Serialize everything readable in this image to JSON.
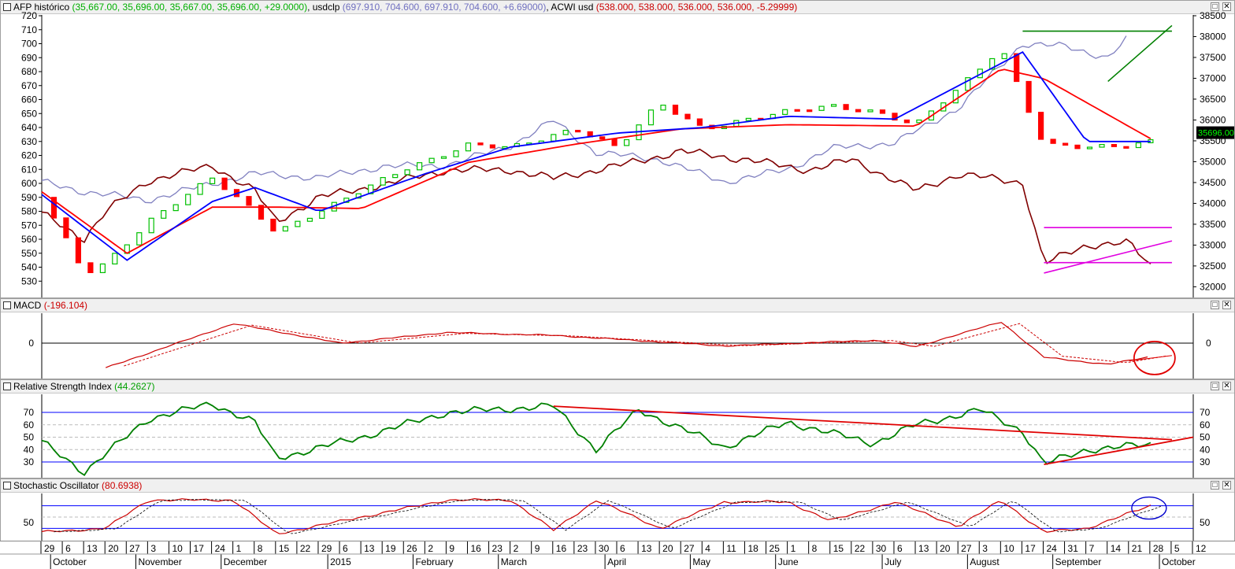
{
  "colors": {
    "afp_up": "#00c000",
    "afp_down": "#ff0000",
    "usdclp": "#8080c0",
    "acwi": "#800000",
    "sma_fast": "#0000ff",
    "sma_slow": "#ff0000",
    "trend_green": "#008000",
    "trend_magenta": "#e000e0",
    "macd": "#cc0000",
    "rsi": "#008000",
    "stoch": "#cc0000",
    "bands": "#0000ff",
    "circle": "#e00000"
  },
  "main": {
    "title_prefix": "AFP histórico",
    "afp_values": "(35,667.00, 35,696.00, 35,667.00, 35,696.00, +29.0000)",
    "usd_name": "usdclp",
    "usd_values": "(697.910, 704.600, 697.910, 704.600, +6.69000)",
    "acwi_name": "ACWI usd",
    "acwi_values": "(538.000, 538.000, 536.000, 536.000, -5.29999)",
    "last_price_badge": "35696.00",
    "left_ticks": [
      "720",
      "710",
      "700",
      "690",
      "680",
      "670",
      "660",
      "650",
      "640",
      "630",
      "620",
      "610",
      "600",
      "590",
      "580",
      "570",
      "560",
      "550",
      "540",
      "530"
    ],
    "right_ticks": [
      "38500",
      "38000",
      "37500",
      "37000",
      "36500",
      "36000",
      "35500",
      "35000",
      "34500",
      "34000",
      "33500",
      "33000",
      "32500",
      "32000"
    ]
  },
  "macd": {
    "title": "MACD",
    "value": "(-196.104)",
    "tick_left": "0",
    "tick_right": "0"
  },
  "rsi": {
    "title": "Relative Strength Index",
    "value": "(44.2627)",
    "ticks": [
      "70",
      "60",
      "50",
      "40",
      "30"
    ]
  },
  "stoch": {
    "title": "Stochastic Oscillator",
    "value": "(80.6938)",
    "tick_left": "50",
    "tick_right": "50"
  },
  "xaxis": {
    "days": [
      "29",
      "6",
      "13",
      "20",
      "27",
      "3",
      "10",
      "17",
      "24",
      "1",
      "8",
      "15",
      "22",
      "29",
      "6",
      "13",
      "19",
      "26",
      "2",
      "9",
      "16",
      "23",
      "2",
      "9",
      "16",
      "23",
      "30",
      "6",
      "13",
      "20",
      "27",
      "4",
      "11",
      "18",
      "25",
      "1",
      "8",
      "15",
      "22",
      "30",
      "6",
      "13",
      "20",
      "27",
      "3",
      "10",
      "17",
      "24",
      "31",
      "7",
      "14",
      "21",
      "28",
      "5",
      "12"
    ],
    "months": [
      "October",
      "November",
      "December",
      "2015",
      "February",
      "March",
      "April",
      "May",
      "June",
      "July",
      "August",
      "September",
      "October"
    ]
  },
  "chart_data": [
    {
      "type": "line",
      "title": "AFP histórico",
      "x_range": [
        "2014-09-29",
        "2015-10-12"
      ],
      "series": [
        {
          "name": "AFP histórico",
          "style": "candles",
          "x": [
            "2014-09-29",
            "2014-10-13",
            "2014-10-20",
            "2014-11-03",
            "2014-11-24",
            "2014-12-08",
            "2014-12-15",
            "2015-01-05",
            "2015-01-26",
            "2015-02-16",
            "2015-03-02",
            "2015-03-23",
            "2015-04-06",
            "2015-04-20",
            "2015-05-04",
            "2015-05-25",
            "2015-06-15",
            "2015-06-29",
            "2015-07-13",
            "2015-07-27",
            "2015-08-10",
            "2015-08-24",
            "2015-09-07",
            "2015-09-21",
            "2015-09-28"
          ],
          "values": [
            590,
            535,
            543,
            573,
            603,
            580,
            566,
            586,
            611,
            627,
            625,
            640,
            625,
            657,
            640,
            648,
            656,
            652,
            641,
            668,
            698,
            627,
            625,
            628,
            631
          ]
        },
        {
          "name": "usdclp",
          "x": [
            "2014-09-29",
            "2014-10-13",
            "2014-11-03",
            "2014-11-24",
            "2014-12-08",
            "2014-12-29",
            "2015-01-19",
            "2015-02-09",
            "2015-03-02",
            "2015-03-16",
            "2015-03-30",
            "2015-04-20",
            "2015-05-11",
            "2015-06-01",
            "2015-06-15",
            "2015-07-06",
            "2015-07-27",
            "2015-08-17",
            "2015-08-31",
            "2015-09-14",
            "2015-09-21"
          ],
          "values": [
            601,
            594,
            588,
            600,
            607,
            604,
            612,
            613,
            627,
            645,
            622,
            617,
            601,
            610,
            625,
            629,
            654,
            700,
            698,
            690,
            705
          ]
        },
        {
          "name": "ACWI usd",
          "x": [
            "2014-09-29",
            "2014-10-13",
            "2014-10-20",
            "2014-11-03",
            "2014-11-24",
            "2014-12-08",
            "2014-12-15",
            "2014-12-29",
            "2015-01-19",
            "2015-02-09",
            "2015-03-02",
            "2015-03-16",
            "2015-04-06",
            "2015-04-27",
            "2015-05-18",
            "2015-06-08",
            "2015-06-22",
            "2015-07-13",
            "2015-07-27",
            "2015-08-17",
            "2015-08-24",
            "2015-09-07",
            "2015-09-21",
            "2015-09-28"
          ],
          "values": [
            33750,
            33150,
            33800,
            34550,
            34900,
            34300,
            33550,
            34150,
            34450,
            34800,
            34800,
            34600,
            34900,
            35250,
            35050,
            34800,
            35050,
            34300,
            34700,
            34500,
            32550,
            33000,
            33050,
            32500
          ]
        },
        {
          "name": "SMA fast",
          "x": [
            "2014-09-29",
            "2014-10-27",
            "2014-11-24",
            "2014-12-08",
            "2014-12-29",
            "2015-02-02",
            "2015-03-02",
            "2015-04-06",
            "2015-05-04",
            "2015-06-01",
            "2015-07-06",
            "2015-08-03",
            "2015-08-17",
            "2015-09-07",
            "2015-09-28"
          ],
          "values": [
            592,
            545,
            587,
            597,
            580,
            607,
            626,
            636,
            640,
            648,
            646,
            678,
            694,
            630,
            630
          ]
        },
        {
          "name": "SMA slow",
          "x": [
            "2014-09-29",
            "2014-10-27",
            "2014-11-24",
            "2014-12-15",
            "2015-01-12",
            "2015-02-16",
            "2015-03-23",
            "2015-04-27",
            "2015-06-01",
            "2015-07-13",
            "2015-08-10",
            "2015-08-24",
            "2015-09-28"
          ],
          "values": [
            594,
            550,
            583,
            583,
            582,
            615,
            628,
            639,
            642,
            641,
            682,
            675,
            632
          ]
        }
      ],
      "yleft_range": [
        520,
        720
      ],
      "yright_range": [
        31800,
        38500
      ]
    },
    {
      "type": "line",
      "title": "MACD",
      "last_value": -196.104,
      "series": [
        {
          "name": "MACD",
          "x": [
            "2014-10-20",
            "2014-12-01",
            "2015-01-05",
            "2015-02-09",
            "2015-03-16",
            "2015-05-11",
            "2015-06-29",
            "2015-07-13",
            "2015-08-10",
            "2015-08-24",
            "2015-09-14",
            "2015-09-28"
          ],
          "values": [
            -0.7,
            0.55,
            0,
            0.3,
            0.22,
            -0.08,
            0.08,
            -0.1,
            0.6,
            -0.4,
            -0.6,
            -0.38
          ]
        }
      ]
    },
    {
      "type": "line",
      "title": "Relative Strength Index",
      "last_value": 44.2627,
      "ylim": [
        15,
        85
      ],
      "series": [
        {
          "name": "Relative Strength Index",
          "x": [
            "2014-09-29",
            "2014-10-13",
            "2014-11-03",
            "2014-11-24",
            "2014-12-08",
            "2014-12-15",
            "2015-01-12",
            "2015-02-09",
            "2015-03-16",
            "2015-03-30",
            "2015-04-13",
            "2015-05-11",
            "2015-06-01",
            "2015-06-29",
            "2015-07-13",
            "2015-08-03",
            "2015-08-17",
            "2015-08-24",
            "2015-09-07",
            "2015-09-28"
          ],
          "values": [
            46,
            22,
            65,
            77,
            62,
            33,
            50,
            70,
            75,
            40,
            72,
            42,
            62,
            45,
            60,
            72,
            55,
            28,
            40,
            44
          ]
        }
      ]
    },
    {
      "type": "line",
      "title": "Stochastic Oscillator",
      "last_value": 80.6938,
      "ylim": [
        0,
        100
      ],
      "series": [
        {
          "name": "Stochastic Oscillator",
          "x": [
            "2014-09-29",
            "2014-10-20",
            "2014-11-03",
            "2014-12-01",
            "2014-12-15",
            "2015-01-12",
            "2015-02-09",
            "2015-03-02",
            "2015-03-16",
            "2015-03-30",
            "2015-04-20",
            "2015-05-11",
            "2015-06-01",
            "2015-06-15",
            "2015-07-06",
            "2015-07-27",
            "2015-08-10",
            "2015-08-24",
            "2015-09-07",
            "2015-09-28"
          ],
          "values": [
            10,
            20,
            95,
            95,
            5,
            50,
            95,
            95,
            15,
            95,
            20,
            90,
            90,
            40,
            90,
            25,
            95,
            10,
            20,
            80
          ]
        }
      ]
    }
  ]
}
